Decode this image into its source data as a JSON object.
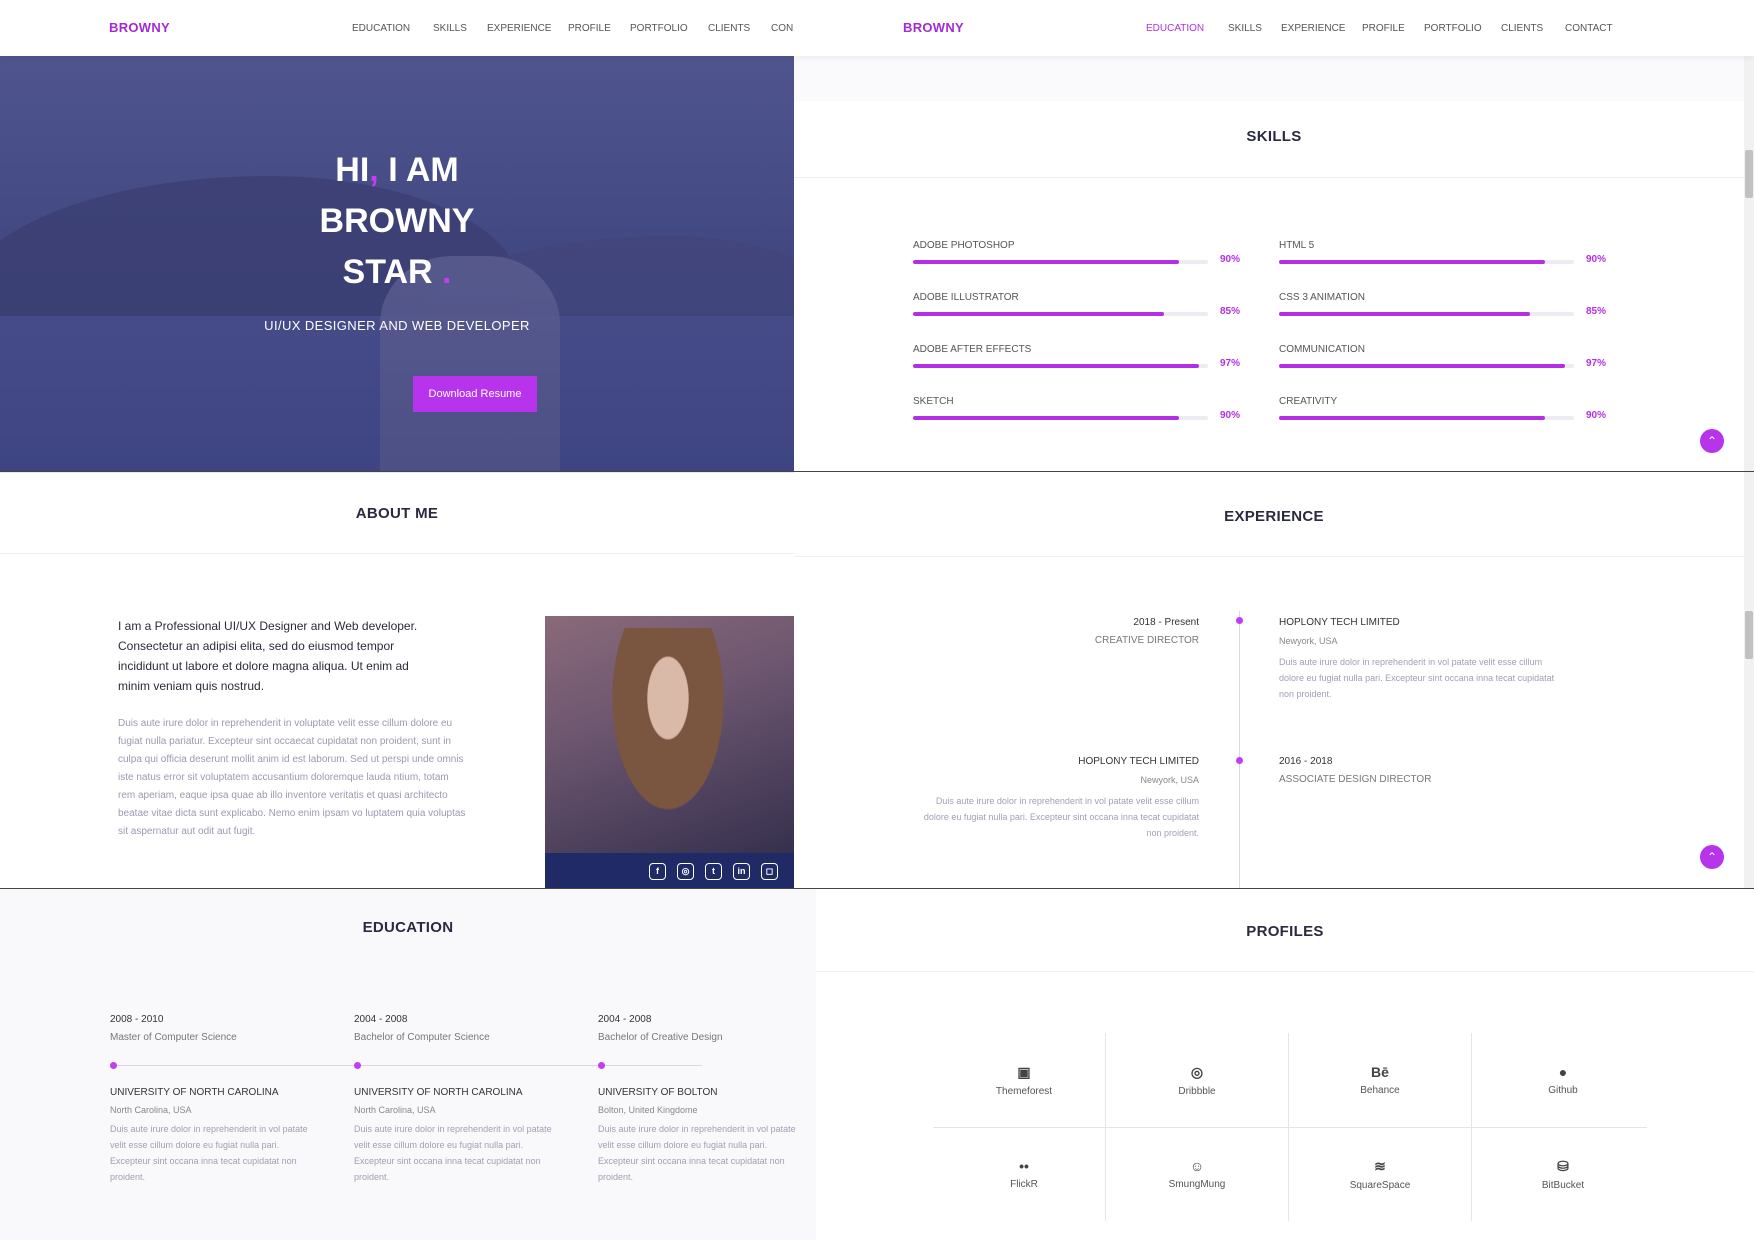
{
  "hero_nav": {
    "brand": "BROWNY",
    "links": [
      "EDUCATION",
      "SKILLS",
      "EXPERIENCE",
      "PROFILE",
      "PORTFOLIO",
      "CLIENTS",
      "CON"
    ]
  },
  "hero": {
    "line1_a": "HI",
    "line1_comma": ",",
    "line1_b": " I AM",
    "line2": "BROWNY",
    "line3": "STAR",
    "line3_dot": ".",
    "subtitle": "UI/UX DESIGNER AND WEB DEVELOPER",
    "button": "Download Resume"
  },
  "skills_nav": {
    "brand": "BROWNY",
    "links": [
      "EDUCATION",
      "SKILLS",
      "EXPERIENCE",
      "PROFILE",
      "PORTFOLIO",
      "CLIENTS",
      "CONTACT"
    ],
    "active": "EDUCATION"
  },
  "skills": {
    "title": "SKILLS",
    "items": [
      {
        "label": "ADOBE PHOTOSHOP",
        "percent": "90%",
        "value": 0.9
      },
      {
        "label": "HTML 5",
        "percent": "90%",
        "value": 0.9
      },
      {
        "label": "ADOBE ILLUSTRATOR",
        "percent": "85%",
        "value": 0.85
      },
      {
        "label": "CSS 3 ANIMATION",
        "percent": "85%",
        "value": 0.85
      },
      {
        "label": "ADOBE AFTER EFFECTS",
        "percent": "97%",
        "value": 0.97
      },
      {
        "label": "COMMUNICATION",
        "percent": "97%",
        "value": 0.97
      },
      {
        "label": "SKETCH",
        "percent": "90%",
        "value": 0.9
      },
      {
        "label": "CREATIVITY",
        "percent": "90%",
        "value": 0.9
      }
    ]
  },
  "about": {
    "title": "ABOUT ME",
    "lead": "I am a Professional UI/UX Designer and Web developer. Consectetur an adipisi elita, sed do eiusmod tempor incididunt ut labore et dolore magna aliqua. Ut enim ad minim veniam quis nostrud.",
    "body": "Duis aute irure dolor in reprehenderit in voluptate velit esse cillum dolore eu fugiat nulla pariatur. Excepteur sint occaecat cupidatat non proident, sunt in culpa qui officia deserunt mollit anim id est laborum. Sed ut perspi unde omnis iste natus error sit voluptatem accusantium doloremque lauda ntium, totam rem aperiam, eaque ipsa quae ab illo inventore veritatis et quasi architecto beatae vitae dicta sunt explicabo. Nemo enim ipsam vo luptatem quia voluptas sit aspernatur aut odit aut fugit.",
    "social": [
      "f",
      "◎",
      "t",
      "in",
      "◻"
    ]
  },
  "experience": {
    "title": "EXPERIENCE",
    "entry1": {
      "date": "2018 - Present",
      "role": "CREATIVE DIRECTOR",
      "company": "HOPLONY TECH LIMITED",
      "location": "Newyork, USA",
      "desc": "Duis aute irure dolor in reprehenderit in vol patate velit esse cillum dolore eu fugiat nulla pari. Excepteur sint occana inna tecat cupidatat non proident."
    },
    "entry2": {
      "company": "HOPLONY TECH LIMITED",
      "location": "Newyork, USA",
      "desc": "Duis aute irure dolor in reprehenderit in vol patate velit esse cillum dolore eu fugiat nulla pari. Excepteur sint occana inna tecat cupidatat non proident.",
      "date": "2016 - 2018",
      "role": "ASSOCIATE DESIGN DIRECTOR"
    }
  },
  "education": {
    "title": "EDUCATION",
    "items": [
      {
        "date": "2008 - 2010",
        "degree": "Master of Computer Science",
        "school": "UNIVERSITY OF NORTH CAROLINA",
        "location": "North Carolina, USA",
        "desc": "Duis aute irure dolor in reprehenderit in vol patate velit esse cillum dolore eu fugiat nulla pari. Excepteur sint occana inna tecat cupidatat non proident."
      },
      {
        "date": "2004 - 2008",
        "degree": "Bachelor of Computer Science",
        "school": "UNIVERSITY OF NORTH CAROLINA",
        "location": "North Carolina, USA",
        "desc": "Duis aute irure dolor in reprehenderit in vol patate velit esse cillum dolore eu fugiat nulla pari. Excepteur sint occana inna tecat cupidatat non proident."
      },
      {
        "date": "2004 - 2008",
        "degree": "Bachelor of Creative Design",
        "school": "UNIVERSITY OF BOLTON",
        "location": "Bolton, United Kingdome",
        "desc": "Duis aute irure dolor in reprehenderit in vol patate velit esse cillum dolore eu fugiat nulla pari. Excepteur sint occana inna tecat cupidatat non proident."
      }
    ]
  },
  "profiles": {
    "title": "PROFILES",
    "items": [
      {
        "icon": "▣",
        "label": "Themeforest"
      },
      {
        "icon": "◎",
        "label": "Dribbble"
      },
      {
        "icon": "Bē",
        "label": "Behance"
      },
      {
        "icon": "●",
        "label": "Github"
      },
      {
        "icon": "••",
        "label": "FlickR"
      },
      {
        "icon": "☺",
        "label": "SmungMung"
      },
      {
        "icon": "≋",
        "label": "SquareSpace"
      },
      {
        "icon": "⛁",
        "label": "BitBucket"
      }
    ]
  },
  "colors": {
    "accent": "#b734ec",
    "brand": "#a42ad8",
    "navy": "#1f2a66"
  },
  "scroll_top_icon": "⌃"
}
